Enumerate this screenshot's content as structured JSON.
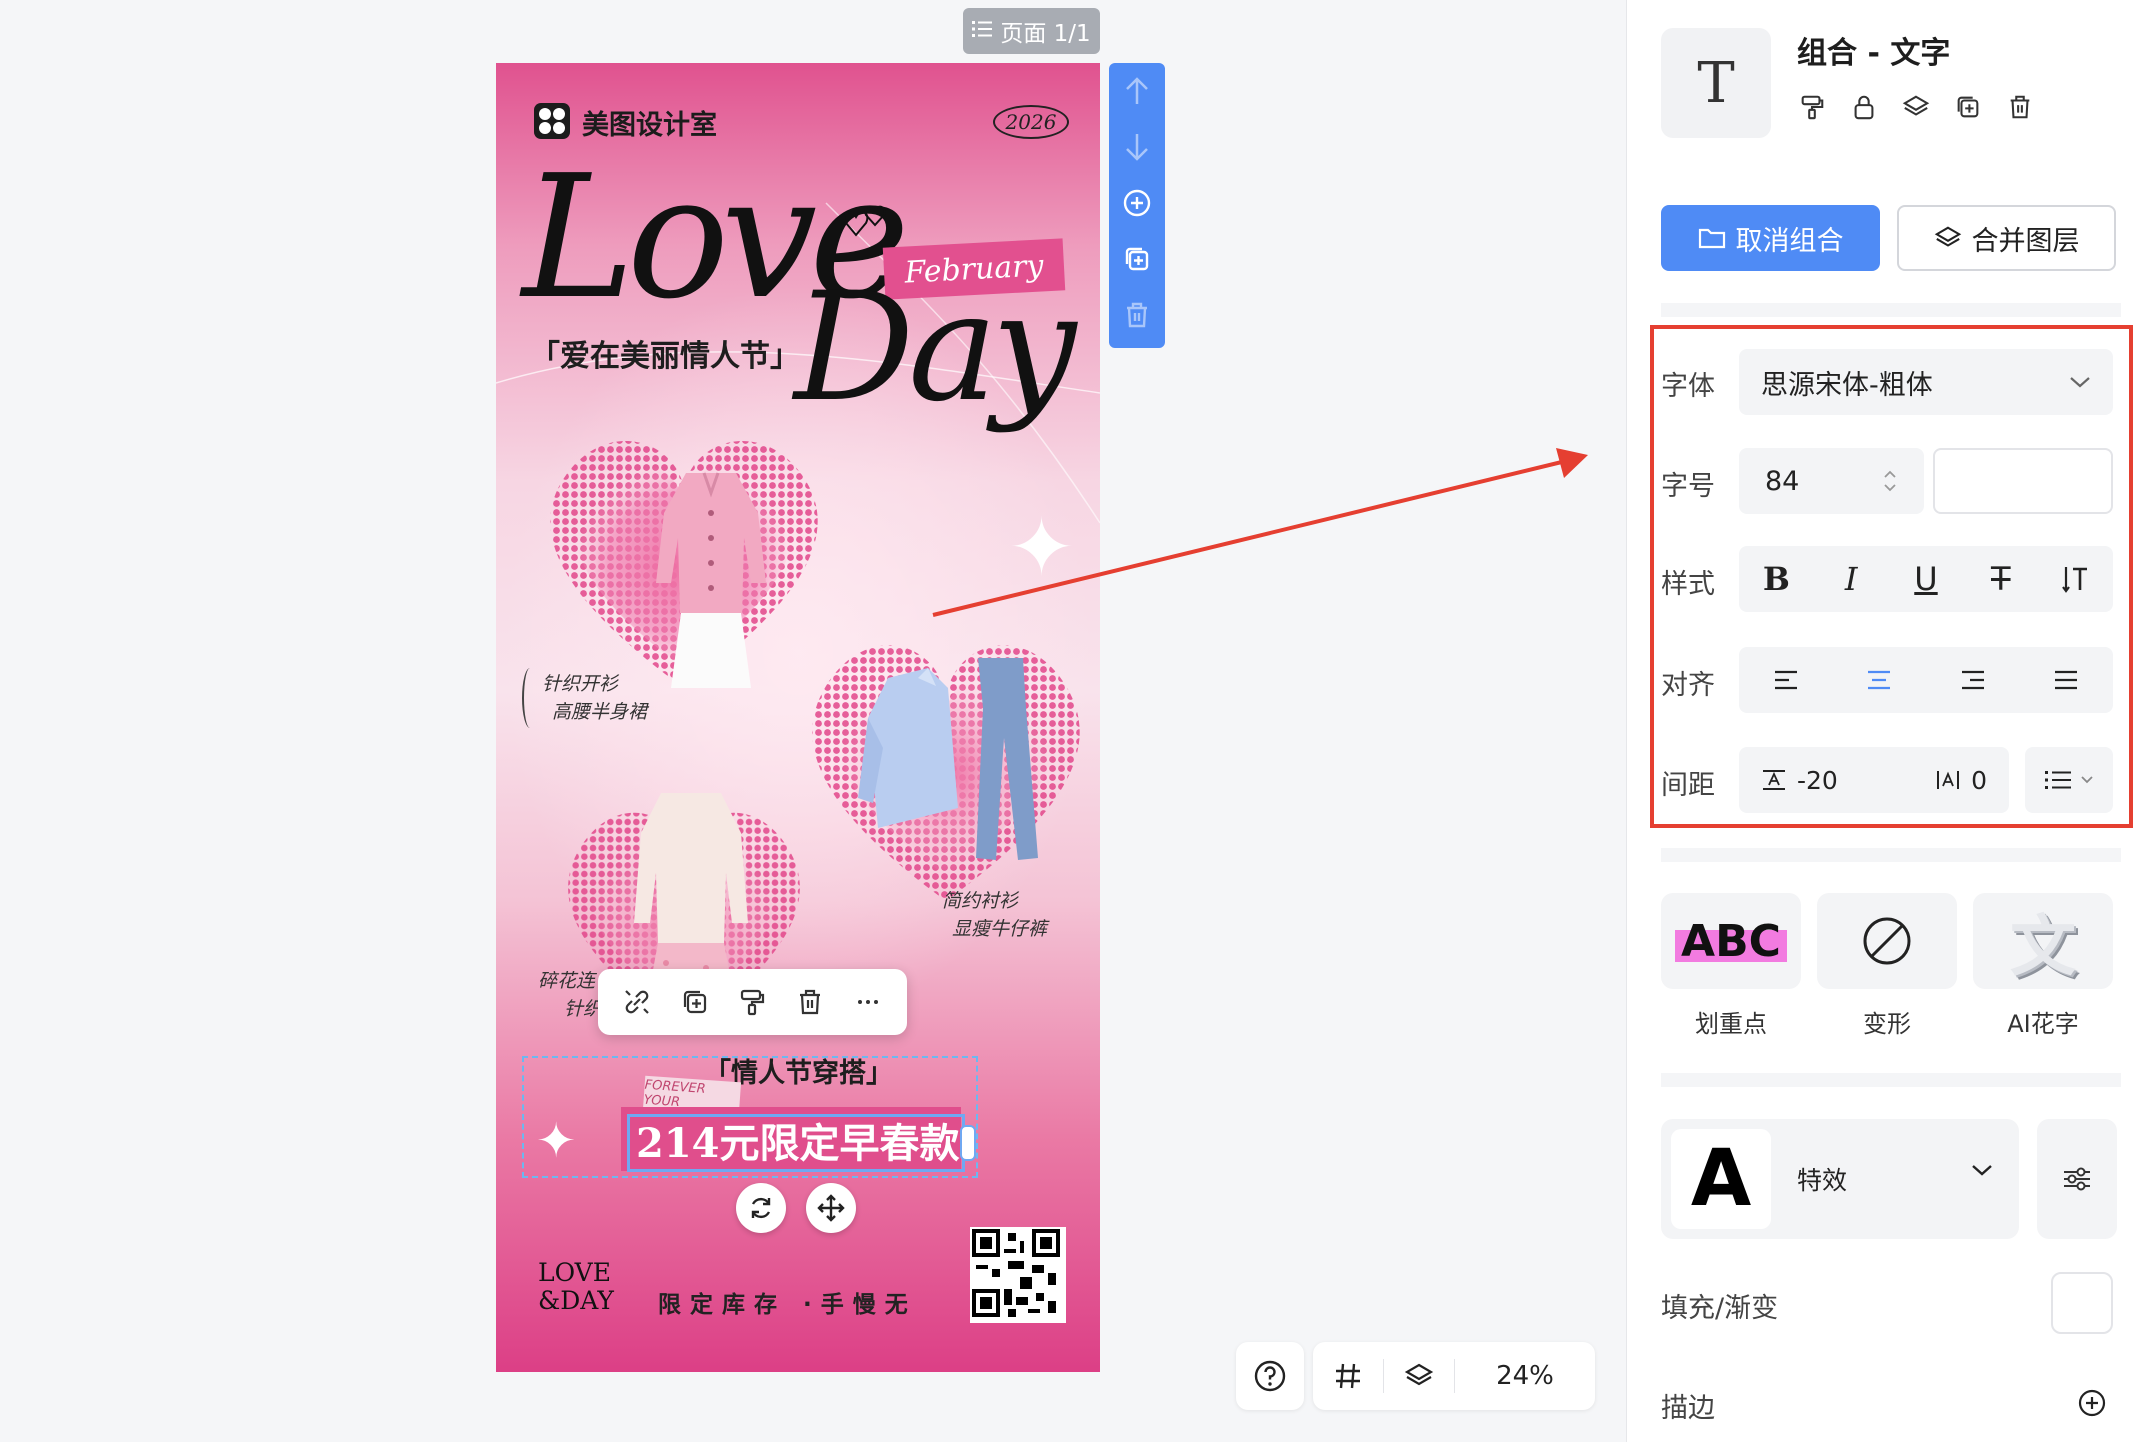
{
  "page_indicator": {
    "label": "页面 1/1"
  },
  "poster": {
    "brand": "美图设计室",
    "year": "2026",
    "title_love": "Love",
    "title_day": "Day",
    "month_tag": "February",
    "subtitle": "「爱在美丽情人节」",
    "captions": [
      {
        "line1": "针织开衫",
        "line2": "高腰半身裙"
      },
      {
        "line1": "简约衬衫",
        "line2": "显瘦牛仔裤"
      },
      {
        "line1": "碎花连",
        "line2": "针织"
      }
    ],
    "bottom_title": "「情人节穿搭」",
    "forever_tag": "FOREVER YOUR",
    "promo": "214元限定早春款",
    "love_day_mini": {
      "line1": "LOVE",
      "line2": "&DAY"
    },
    "stock_text": "限定库存 ·手慢无"
  },
  "zoom": {
    "value": "24%"
  },
  "panel": {
    "title": "组合 - 文字",
    "type_icon": "T",
    "quick_icons": [
      "format-painter-icon",
      "lock-icon",
      "layers-icon",
      "duplicate-icon",
      "trash-icon"
    ],
    "ungroup_label": "取消组合",
    "merge_label": "合并图层",
    "font_label": "字体",
    "font_value": "思源宋体-粗体",
    "size_label": "字号",
    "size_value": "84",
    "style_label": "样式",
    "align_label": "对齐",
    "align_selected": "center",
    "spacing_label": "间距",
    "letter_spacing": "-20",
    "line_spacing": "0",
    "effects": [
      {
        "label": "划重点",
        "preview": "ABC"
      },
      {
        "label": "变形"
      },
      {
        "label": "AI花字",
        "preview": "文"
      }
    ],
    "special_effect_label": "特效",
    "special_effect_preview": "A",
    "fill_label": "填充/渐变",
    "stroke_label": "描边"
  },
  "colors": {
    "accent_blue": "#4f8bf5",
    "annotation_red": "#e53f31",
    "poster_pink": "#e04e8c"
  }
}
